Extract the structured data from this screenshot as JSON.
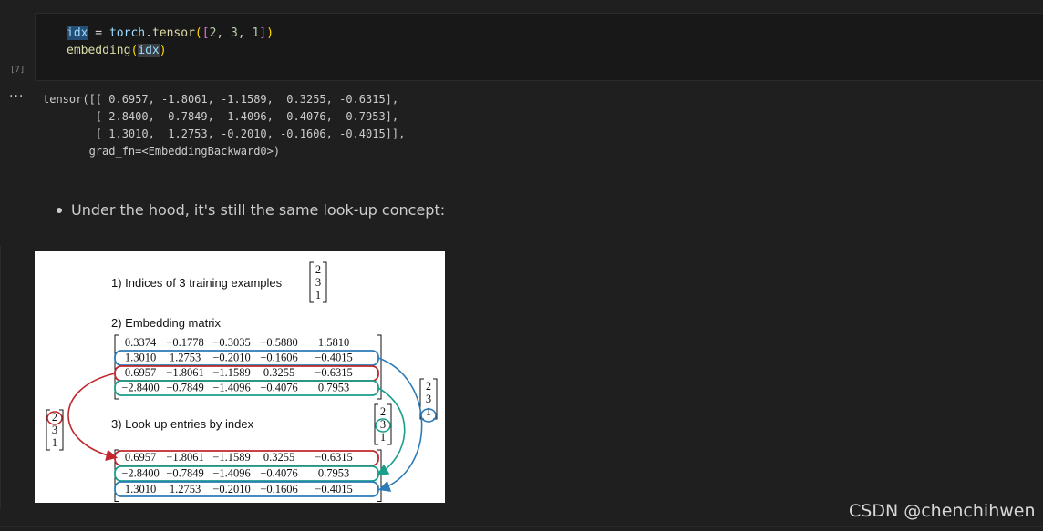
{
  "code_cell": {
    "execution_count": "[7]",
    "line1": {
      "var": "idx",
      "op": " = ",
      "mod": "torch",
      "dot": ".",
      "fn": "tensor",
      "p1": "(",
      "b1": "[",
      "n1": "2",
      "c1": ", ",
      "n2": "3",
      "c2": ", ",
      "n3": "1",
      "b2": "]",
      "p2": ")"
    },
    "line2": {
      "fn": "embedding",
      "p1": "(",
      "var": "idx",
      "p2": ")"
    }
  },
  "output": {
    "dots": "···",
    "text": "tensor([[ 0.6957, -1.8061, -1.1589,  0.3255, -0.6315],\n        [-2.8400, -0.7849, -1.4096, -0.4076,  0.7953],\n        [ 1.3010,  1.2753, -0.2010, -0.1606, -0.4015]],\n       grad_fn=<EmbeddingBackward0>)"
  },
  "markdown": {
    "bullet": "Under the hood, it's still the same look-up concept:"
  },
  "figure": {
    "step1": "1) Indices of 3 training examples",
    "step2": "2) Embedding matrix",
    "step3": "3) Look up entries by index",
    "indices": [
      "2",
      "3",
      "1"
    ],
    "embedding_rows": [
      [
        "0.3374",
        "−0.1778",
        "−0.3035",
        "−0.5880",
        "1.5810"
      ],
      [
        "1.3010",
        "1.2753",
        "−0.2010",
        "−0.1606",
        "−0.4015"
      ],
      [
        "0.6957",
        "−1.8061",
        "−1.1589",
        "0.3255",
        "−0.6315"
      ],
      [
        "−2.8400",
        "−0.7849",
        "−1.4096",
        "−0.4076",
        "0.7953"
      ]
    ],
    "result_rows": [
      [
        "0.6957",
        "−1.8061",
        "−1.1589",
        "0.3255",
        "−0.6315"
      ],
      [
        "−2.8400",
        "−0.7849",
        "−1.4096",
        "−0.4076",
        "0.7953"
      ],
      [
        "1.3010",
        "1.2753",
        "−0.2010",
        "−0.1606",
        "−0.4015"
      ]
    ],
    "colors": {
      "red": "#c0282e",
      "teal": "#1a9e8c",
      "blue": "#2c7bb6"
    }
  },
  "watermark": "CSDN @chenchihwen"
}
